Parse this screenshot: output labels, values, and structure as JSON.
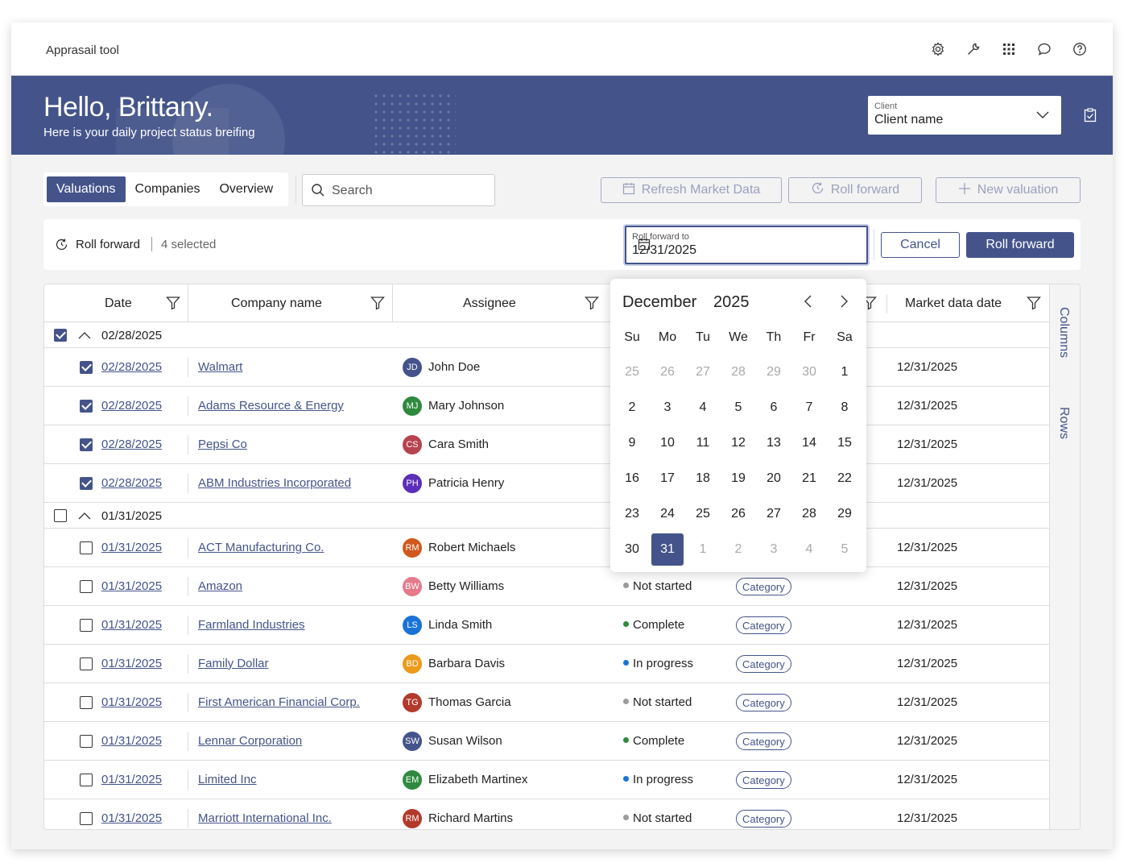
{
  "app": {
    "title": "Apprasail tool"
  },
  "topbar_icons": [
    "gear-icon",
    "wrench-icon",
    "grid-icon",
    "chat-icon",
    "help-icon"
  ],
  "banner": {
    "greeting": "Hello, Brittany.",
    "subtitle": "Here is your daily project status breifing"
  },
  "client_select": {
    "label": "Client",
    "value": "Client name"
  },
  "tabs": [
    {
      "label": "Valuations",
      "active": true
    },
    {
      "label": "Companies",
      "active": false
    },
    {
      "label": "Overview",
      "active": false
    }
  ],
  "search": {
    "placeholder": "Search"
  },
  "actions": {
    "refresh": "Refresh Market Data",
    "roll_forward": "Roll forward",
    "new_valuation": "New valuation"
  },
  "roll_bar": {
    "title": "Roll forward",
    "selected": "4 selected",
    "date_label": "Roll forward to",
    "date_value": "12/31/2025",
    "cancel": "Cancel",
    "confirm": "Roll forward"
  },
  "columns": {
    "date": "Date",
    "company": "Company name",
    "assignee": "Assignee",
    "market_date": "Market data date"
  },
  "side_panel": {
    "columns": "Columns",
    "rows": "Rows"
  },
  "groups": [
    {
      "label": "02/28/2025",
      "checked": true,
      "rows": [
        {
          "date": "02/28/2025",
          "company": "Walmart",
          "initials": "JD",
          "assignee": "John Doe",
          "avatar_color": "#44548a",
          "status": "",
          "status_color": "",
          "category": "",
          "market_date": "12/31/2025",
          "checked": true
        },
        {
          "date": "02/28/2025",
          "company": "Adams Resource & Energy",
          "initials": "MJ",
          "assignee": "Mary Johnson",
          "avatar_color": "#2e8a3e",
          "status": "",
          "status_color": "",
          "category": "",
          "market_date": "12/31/2025",
          "checked": true
        },
        {
          "date": "02/28/2025",
          "company": "Pepsi Co",
          "initials": "CS",
          "assignee": "Cara Smith",
          "avatar_color": "#b6434f",
          "status": "",
          "status_color": "",
          "category": "",
          "market_date": "12/31/2025",
          "checked": true
        },
        {
          "date": "02/28/2025",
          "company": "ABM Industries Incorporated",
          "initials": "PH",
          "assignee": "Patricia Henry",
          "avatar_color": "#5b2fb8",
          "status": "",
          "status_color": "",
          "category": "",
          "market_date": "12/31/2025",
          "checked": true
        }
      ]
    },
    {
      "label": "01/31/2025",
      "checked": false,
      "rows": [
        {
          "date": "01/31/2025",
          "company": "ACT Manufacturing Co.",
          "initials": "RM",
          "assignee": "Robert Michaels",
          "avatar_color": "#d0581c",
          "status": "",
          "status_color": "",
          "category": "",
          "market_date": "12/31/2025",
          "checked": false
        },
        {
          "date": "01/31/2025",
          "company": "Amazon",
          "initials": "BW",
          "assignee": "Betty Williams",
          "avatar_color": "#e57a8a",
          "status": "Not started",
          "status_color": "#9a9a9a",
          "category": "Category",
          "market_date": "12/31/2025",
          "checked": false
        },
        {
          "date": "01/31/2025",
          "company": "Farmland Industries",
          "initials": "LS",
          "assignee": "Linda Smith",
          "avatar_color": "#1a73d6",
          "status": "Complete",
          "status_color": "#2e8a3e",
          "category": "Category",
          "market_date": "12/31/2025",
          "checked": false
        },
        {
          "date": "01/31/2025",
          "company": "Family Dollar",
          "initials": "BD",
          "assignee": "Barbara Davis",
          "avatar_color": "#ec9a1a",
          "status": "In progress",
          "status_color": "#1a73d6",
          "category": "Category",
          "market_date": "12/31/2025",
          "checked": false
        },
        {
          "date": "01/31/2025",
          "company": "First American Financial Corp.",
          "initials": "TG",
          "assignee": "Thomas Garcia",
          "avatar_color": "#b23a2c",
          "status": "Not started",
          "status_color": "#9a9a9a",
          "category": "Category",
          "market_date": "12/31/2025",
          "checked": false
        },
        {
          "date": "01/31/2025",
          "company": "Lennar Corporation",
          "initials": "SW",
          "assignee": "Susan Wilson",
          "avatar_color": "#44548a",
          "status": "Complete",
          "status_color": "#2e8a3e",
          "category": "Category",
          "market_date": "12/31/2025",
          "checked": false
        },
        {
          "date": "01/31/2025",
          "company": "Limited Inc",
          "initials": "EM",
          "assignee": "Elizabeth Martinex",
          "avatar_color": "#2e8a3e",
          "status": "In progress",
          "status_color": "#1a73d6",
          "category": "Category",
          "market_date": "12/31/2025",
          "checked": false
        },
        {
          "date": "01/31/2025",
          "company": "Marriott International Inc.",
          "initials": "RM",
          "assignee": "Richard Martins",
          "avatar_color": "#b23a2c",
          "status": "Not started",
          "status_color": "#9a9a9a",
          "category": "Category",
          "market_date": "12/31/2025",
          "checked": false
        }
      ]
    }
  ],
  "calendar": {
    "month": "December",
    "year": "2025",
    "weekdays": [
      "Su",
      "Mo",
      "Tu",
      "We",
      "Th",
      "Fr",
      "Sa"
    ],
    "weeks": [
      [
        "25",
        "26",
        "27",
        "28",
        "29",
        "30",
        "1"
      ],
      [
        "2",
        "3",
        "4",
        "5",
        "6",
        "7",
        "8"
      ],
      [
        "9",
        "10",
        "11",
        "12",
        "13",
        "14",
        "15"
      ],
      [
        "16",
        "17",
        "18",
        "19",
        "20",
        "21",
        "22"
      ],
      [
        "23",
        "24",
        "25",
        "26",
        "27",
        "28",
        "29"
      ],
      [
        "30",
        "31",
        "1",
        "2",
        "3",
        "4",
        "5"
      ]
    ],
    "selected": "31"
  },
  "colors": {
    "primary": "#44548a",
    "banner": "#44548a",
    "background": "#f3f3f3"
  }
}
